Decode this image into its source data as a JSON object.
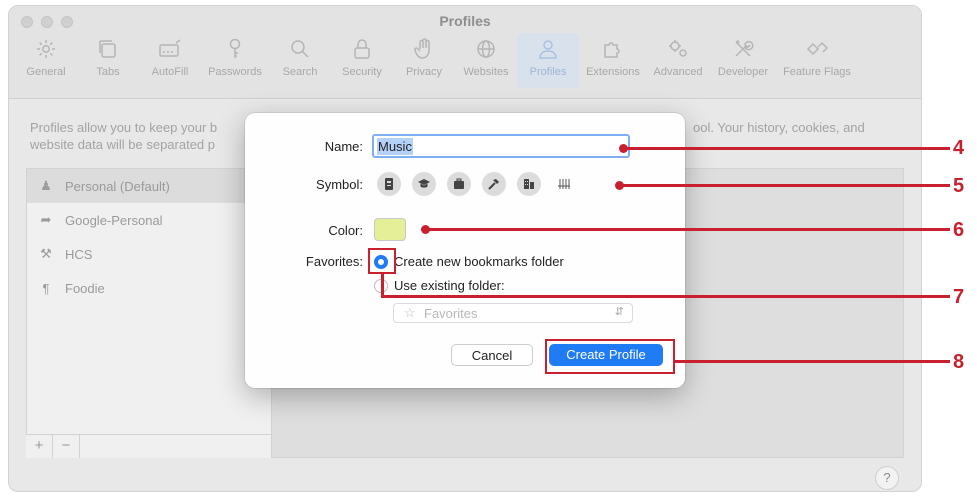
{
  "window": {
    "title": "Profiles"
  },
  "toolbar": {
    "items": [
      {
        "label": "General",
        "icon": "gear-icon"
      },
      {
        "label": "Tabs",
        "icon": "tabs-icon"
      },
      {
        "label": "AutoFill",
        "icon": "autofill-icon"
      },
      {
        "label": "Passwords",
        "icon": "key-icon"
      },
      {
        "label": "Search",
        "icon": "magnifier-icon"
      },
      {
        "label": "Security",
        "icon": "lock-icon"
      },
      {
        "label": "Privacy",
        "icon": "hand-icon"
      },
      {
        "label": "Websites",
        "icon": "globe-icon"
      },
      {
        "label": "Profiles",
        "icon": "person-icon"
      },
      {
        "label": "Extensions",
        "icon": "puzzle-icon"
      },
      {
        "label": "Advanced",
        "icon": "gears-icon"
      },
      {
        "label": "Developer",
        "icon": "tools-icon"
      },
      {
        "label": "Feature Flags",
        "icon": "flags-icon"
      }
    ],
    "selected": "Profiles"
  },
  "intro": {
    "line1": "Profiles allow you to keep your b",
    "line1_end": "ool. Your history, cookies, and",
    "line2": "website data will be separated p"
  },
  "profiles_list": {
    "items": [
      {
        "label": "Personal (Default)",
        "icon": "person-icon",
        "selected": true
      },
      {
        "label": "Google-Personal",
        "icon": "rocket-icon",
        "selected": false
      },
      {
        "label": "HCS",
        "icon": "tools-icon",
        "selected": false
      },
      {
        "label": "Foodie",
        "icon": "fork-knife-icon",
        "selected": false
      }
    ],
    "add_label": "+",
    "remove_label": "−"
  },
  "help": {
    "label": "?"
  },
  "dialog": {
    "name_label": "Name:",
    "name_value": "Music",
    "symbol_label": "Symbol:",
    "symbols": [
      "id-badge-icon",
      "graduation-cap-icon",
      "briefcase-icon",
      "hammer-icon",
      "building-icon",
      "music-stand-icon"
    ],
    "color_label": "Color:",
    "color_value": "#e5ef98",
    "favorites_label": "Favorites:",
    "option_new": "Create new bookmarks folder",
    "option_existing": "Use existing folder:",
    "folder_popup": "Favorites",
    "cancel_label": "Cancel",
    "create_label": "Create Profile"
  },
  "annotations": {
    "labels": [
      "4",
      "5",
      "6",
      "7",
      "8"
    ],
    "color": "#c8202f"
  }
}
